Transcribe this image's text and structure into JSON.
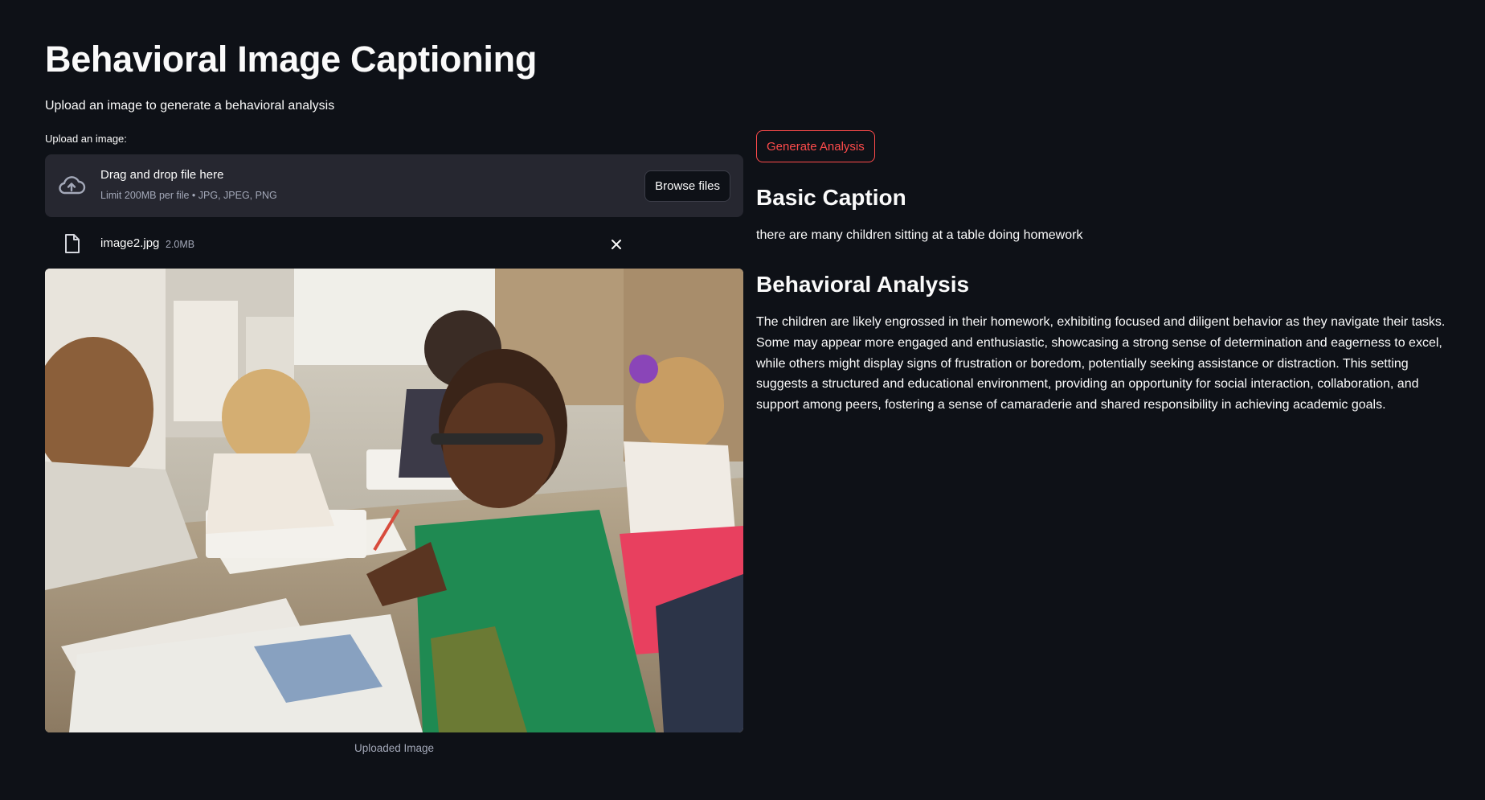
{
  "page": {
    "title": "Behavioral Image Captioning",
    "subtitle": "Upload an image to generate a behavioral analysis"
  },
  "uploader": {
    "label": "Upload an image:",
    "drop_text": "Drag and drop file here",
    "limit_text": "Limit 200MB per file • JPG, JPEG, PNG",
    "browse_label": "Browse files",
    "icon": "cloud-upload-icon",
    "file": {
      "name": "image2.jpg",
      "size": "2.0MB",
      "icon": "file-icon",
      "remove_icon": "close-icon"
    }
  },
  "image": {
    "caption": "Uploaded Image"
  },
  "actions": {
    "generate_label": "Generate Analysis",
    "accent_color": "#ff4b4b"
  },
  "results": {
    "basic_heading": "Basic Caption",
    "basic_text": "there are many children sitting at a table doing homework",
    "behavior_heading": "Behavioral Analysis",
    "behavior_text": "The children are likely engrossed in their homework, exhibiting focused and diligent behavior as they navigate their tasks. Some may appear more engaged and enthusiastic, showcasing a strong sense of determination and eagerness to excel, while others might display signs of frustration or boredom, potentially seeking assistance or distraction. This setting suggests a structured and educational environment, providing an opportunity for social interaction, collaboration, and support among peers, fostering a sense of camaraderie and shared responsibility in achieving academic goals."
  },
  "theme": {
    "background": "#0e1117",
    "panel": "#262730",
    "text": "#fafafa",
    "muted": "#a3a8b8"
  }
}
